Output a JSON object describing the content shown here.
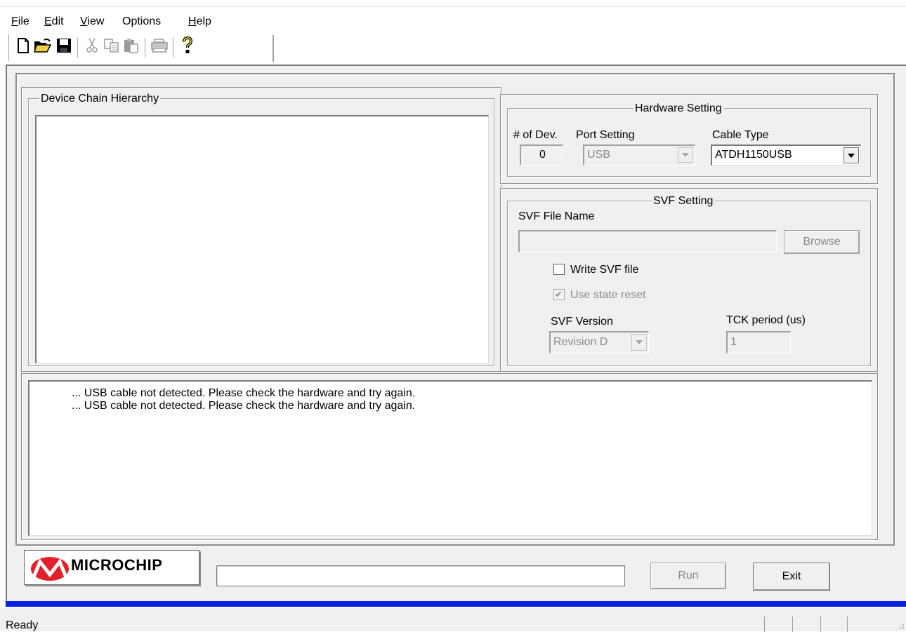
{
  "menu": {
    "items": [
      {
        "label": "File",
        "access": "F",
        "rest": "ile"
      },
      {
        "label": "Edit",
        "access": "E",
        "rest": "dit"
      },
      {
        "label": "View",
        "access": "V",
        "rest": "iew"
      },
      {
        "label": "Options",
        "access": "",
        "rest": "Options"
      },
      {
        "label": "Help",
        "access": "H",
        "rest": "elp"
      }
    ]
  },
  "toolbar": {
    "icons": [
      "new-icon",
      "open-icon",
      "save-icon",
      "cut-icon",
      "copy-icon",
      "paste-icon",
      "print-icon",
      "help-icon"
    ],
    "help_glyph": "?"
  },
  "device_chain": {
    "title": "Device Chain Hierarchy"
  },
  "hardware": {
    "title": "Hardware Setting",
    "num_dev_label": "# of Dev.",
    "num_dev_value": "0",
    "port_label": "Port Setting",
    "port_value": "USB",
    "cable_label": "Cable Type",
    "cable_value": "ATDH1150USB"
  },
  "svf": {
    "title": "SVF Setting",
    "file_name_label": "SVF File Name",
    "file_name_value": "",
    "browse_label": "Browse",
    "write_svf_label": "Write SVF file",
    "write_svf_checked": false,
    "use_state_reset_label": "Use state reset",
    "use_state_reset_checked": true,
    "version_label": "SVF Version",
    "version_value": "Revision D",
    "tck_label": "TCK period (us)",
    "tck_value": "1",
    "check_glyph": "✔"
  },
  "log": {
    "lines": [
      "... USB cable not detected. Please check the hardware and try again.",
      "... USB cable not detected. Please check the hardware and try again."
    ]
  },
  "footer": {
    "logo_text": "MICROCHIP",
    "run_label": "Run",
    "exit_label": "Exit",
    "progress_percent": 0
  },
  "status": {
    "text": "Ready"
  },
  "colors": {
    "accent_bar": "#0a1fe6",
    "logo_red": "#e0202a"
  }
}
